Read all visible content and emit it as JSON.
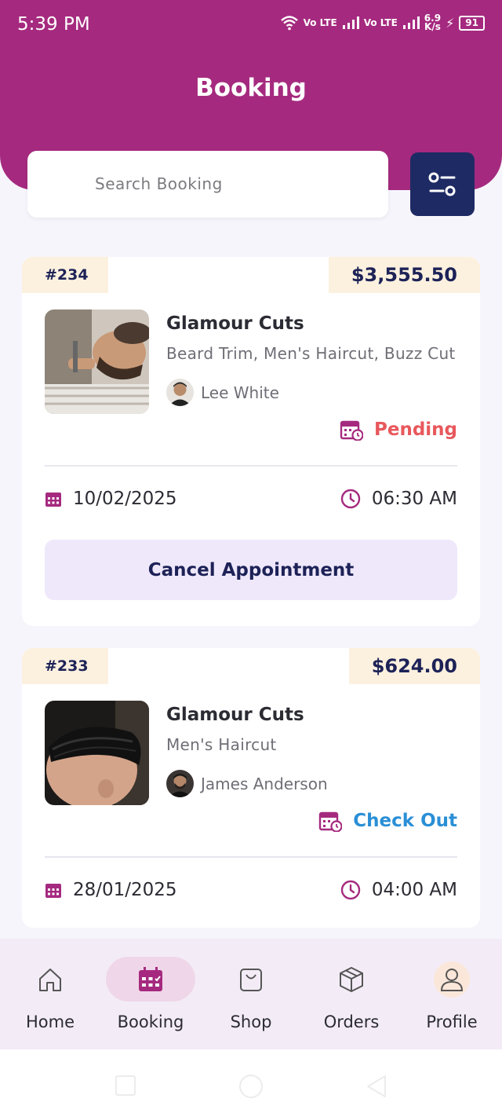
{
  "status_bar": {
    "time": "5:39 PM",
    "network_1": "Vo LTE",
    "network_2": "Vo LTE",
    "speed": "6.9",
    "speed_unit": "K/s",
    "battery": "91"
  },
  "header": {
    "title": "Booking"
  },
  "search": {
    "placeholder": "Search Booking"
  },
  "colors": {
    "header": "#a52a7f",
    "navy": "#1d2257",
    "pending": "#e8585c",
    "checkout": "#2a8fd6",
    "accent": "#a52a7f"
  },
  "bookings": [
    {
      "id": "#234",
      "price": "$3,555.50",
      "shop": "Glamour Cuts",
      "services": "Beard Trim, Men's Haircut, Buzz Cut",
      "barber": "Lee White",
      "status": "Pending",
      "date": "10/02/2025",
      "time": "06:30 AM",
      "action": "Cancel Appointment"
    },
    {
      "id": "#233",
      "price": "$624.00",
      "shop": "Glamour Cuts",
      "services": "Men's Haircut",
      "barber": "James Anderson",
      "status": "Check Out",
      "date": "28/01/2025",
      "time": "04:00 AM"
    }
  ],
  "nav": {
    "items": [
      {
        "label": "Home",
        "icon": "home-icon"
      },
      {
        "label": "Booking",
        "icon": "calendar-icon",
        "active": true
      },
      {
        "label": "Shop",
        "icon": "shopping-bag-icon"
      },
      {
        "label": "Orders",
        "icon": "box-icon"
      },
      {
        "label": "Profile",
        "icon": "user-icon"
      }
    ]
  }
}
